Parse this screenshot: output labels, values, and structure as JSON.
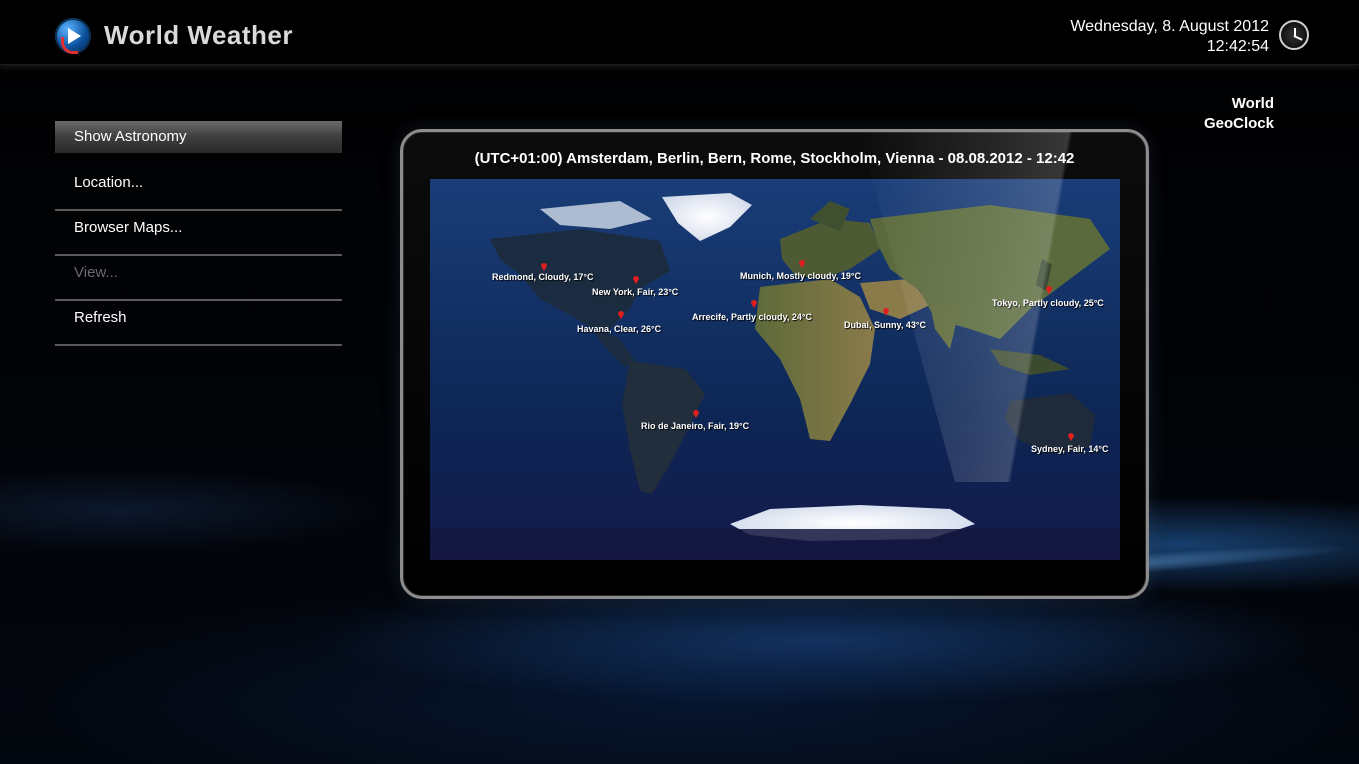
{
  "header": {
    "app_title": "World Weather",
    "date": "Wednesday, 8. August 2012",
    "time": "12:42:54"
  },
  "menu": {
    "items": [
      {
        "label": "Show Astronomy",
        "state": "active"
      },
      {
        "label": "Location...",
        "state": "normal"
      },
      {
        "label": "Browser Maps...",
        "state": "normal"
      },
      {
        "label": "View...",
        "state": "disabled"
      },
      {
        "label": "Refresh",
        "state": "normal"
      }
    ]
  },
  "geo_label": {
    "line1": "World",
    "line2": "GeoClock"
  },
  "map": {
    "caption": "(UTC+01:00) Amsterdam, Berlin, Bern, Rome, Stockholm, Vienna - 08.08.2012 - 12:42",
    "cities": [
      {
        "label": "Redmond, Cloudy, 17°C"
      },
      {
        "label": "New York, Fair, 23°C"
      },
      {
        "label": "Havana, Clear, 26°C"
      },
      {
        "label": "Munich, Mostly cloudy, 19°C"
      },
      {
        "label": "Arrecife, Partly cloudy, 24°C"
      },
      {
        "label": "Dubai, Sunny, 43°C"
      },
      {
        "label": "Tokyo, Partly cloudy, 25°C"
      },
      {
        "label": "Rio de Janeiro, Fair, 19°C"
      },
      {
        "label": "Sydney, Fair, 14°C"
      }
    ]
  },
  "colors": {
    "ocean": "#0e2a5a",
    "land_day": "#6e6a3c",
    "land_night": "#1b2a3c",
    "ice": "#e8eef6",
    "pin": "#e02020",
    "accent_blue": "#2a7bd6"
  },
  "icons": {
    "app_logo": "play-logo-icon",
    "clock": "clock-icon",
    "pin": "map-pin-icon"
  }
}
